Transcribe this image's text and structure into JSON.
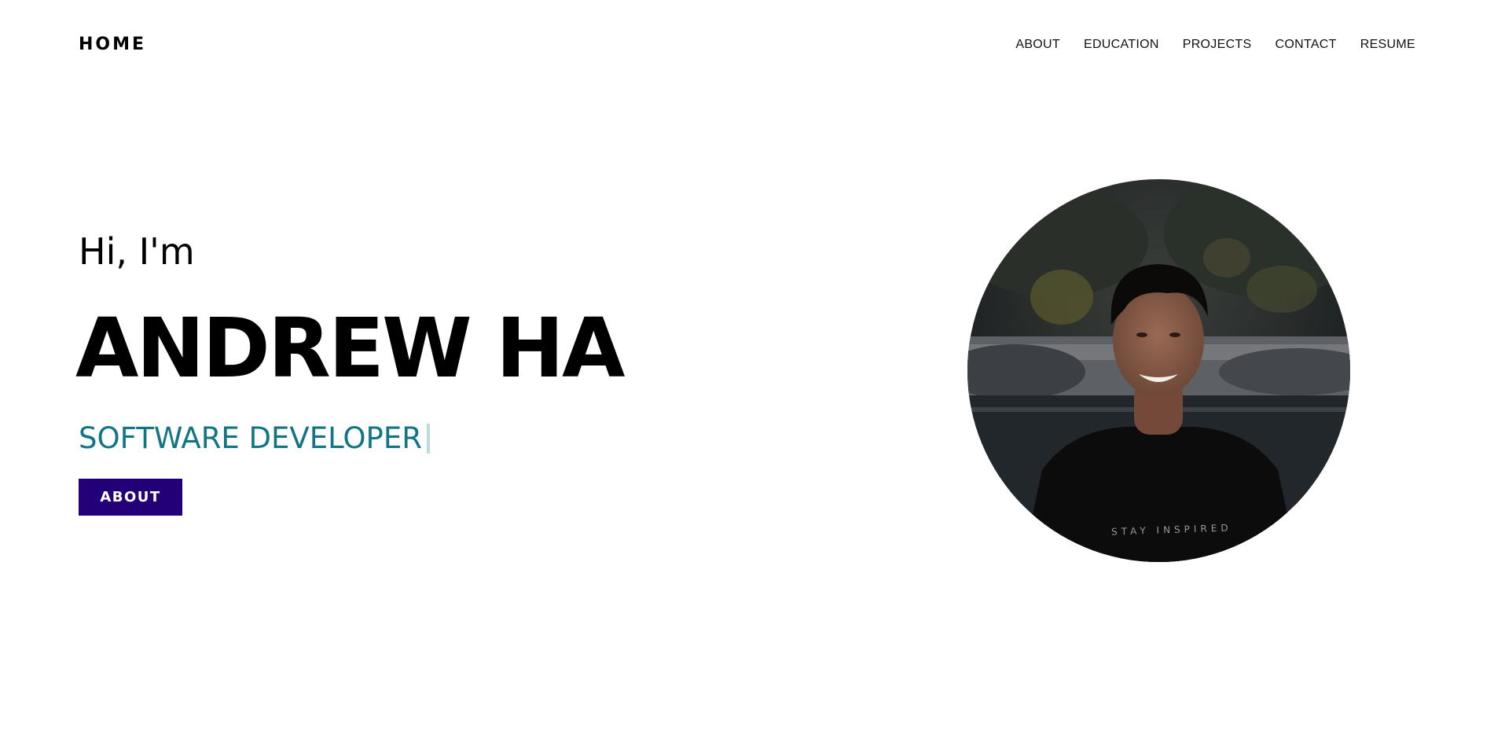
{
  "header": {
    "logo": "HOME",
    "nav": [
      "ABOUT",
      "EDUCATION",
      "PROJECTS",
      "CONTACT",
      "RESUME"
    ]
  },
  "hero": {
    "greeting": "Hi, I'm",
    "name": "ANDREW HA",
    "role": "SOFTWARE DEVELOPER",
    "button_label": "ABOUT",
    "shirt_text": "STAY INSPIRED"
  },
  "colors": {
    "role_text": "#117585",
    "button_bg": "#230078",
    "cursor": "#b9dbe4"
  }
}
